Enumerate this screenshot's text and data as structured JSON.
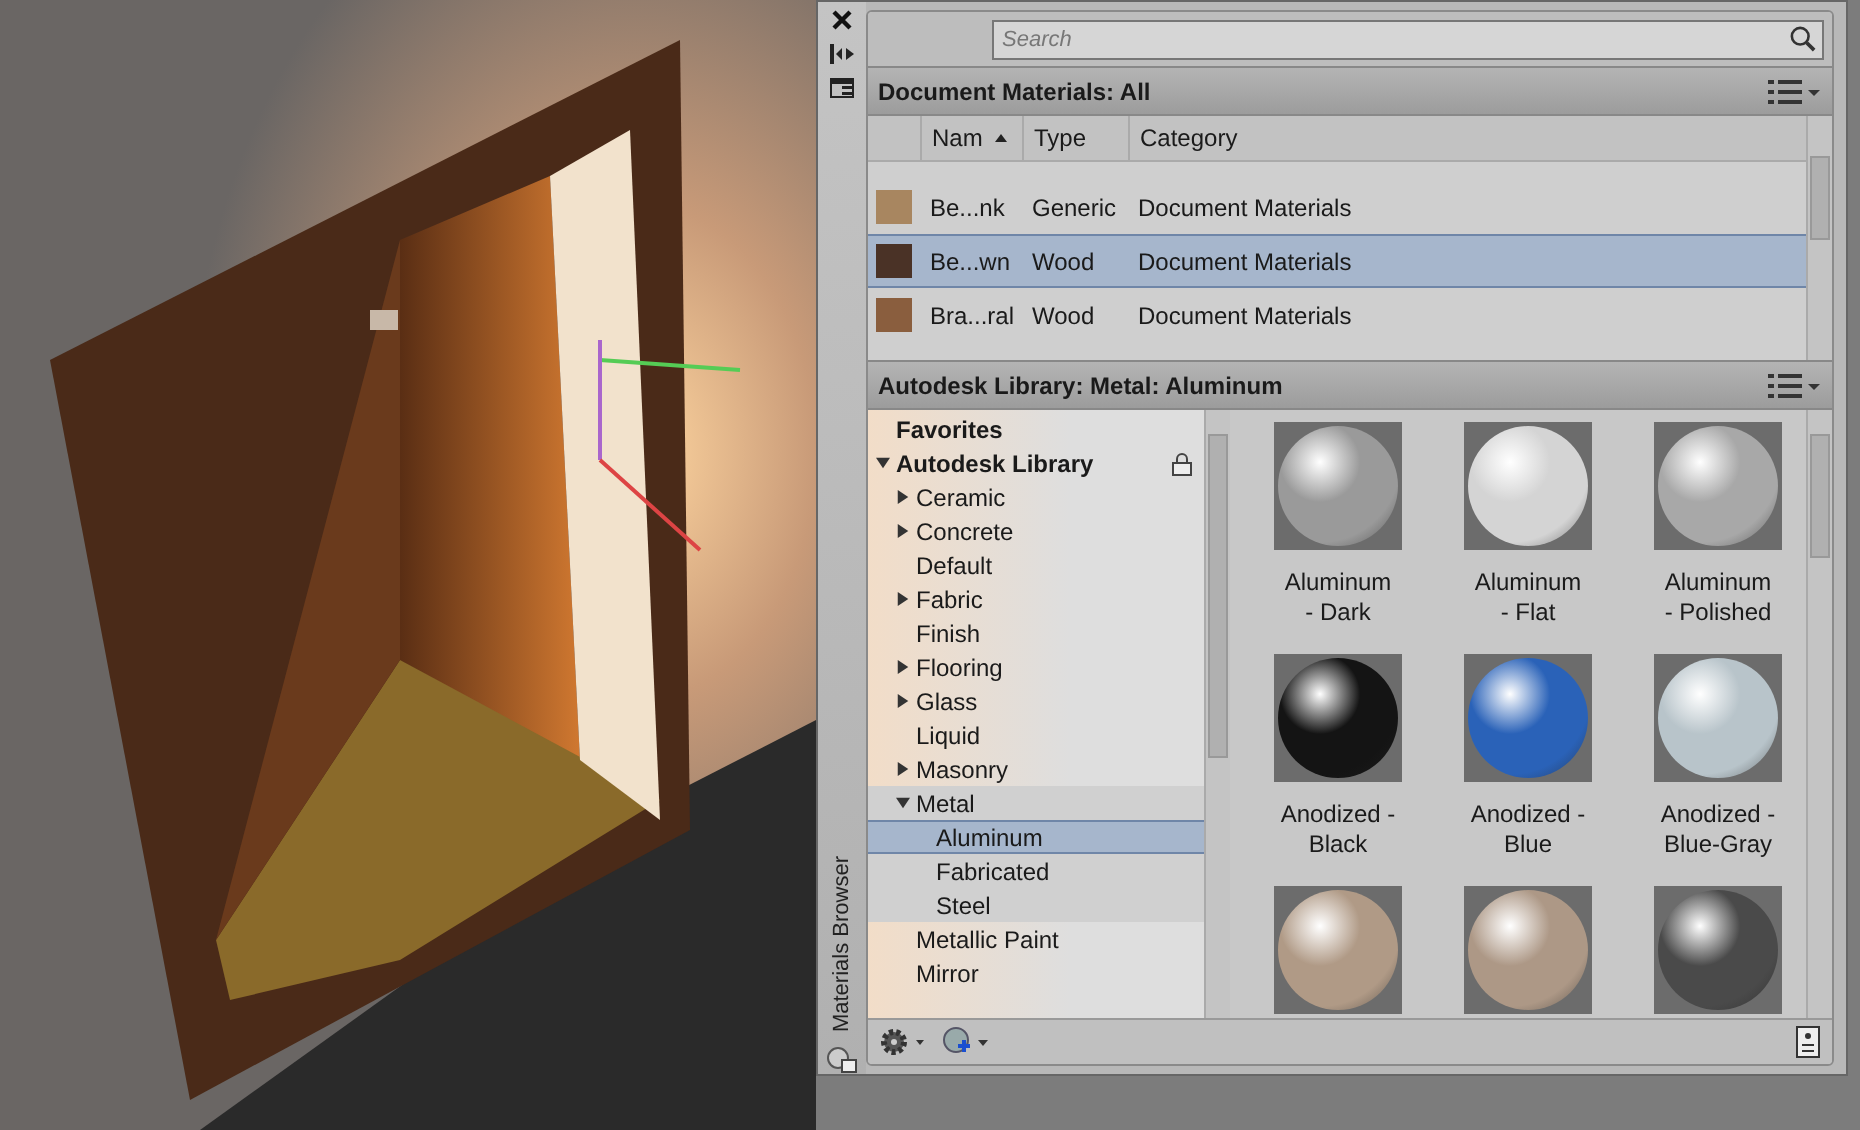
{
  "side_strip": {
    "title": "Materials Browser"
  },
  "search": {
    "placeholder": "Search"
  },
  "document_materials": {
    "title": "Document Materials: All",
    "columns": [
      {
        "label": "Nam",
        "sorted": true
      },
      {
        "label": "Type",
        "sorted": false
      },
      {
        "label": "Category",
        "sorted": false
      }
    ],
    "rows": [
      {
        "color": "#a88660",
        "name": "Be...nk",
        "type": "Generic",
        "category": "Document Materials",
        "selected": false
      },
      {
        "color": "#4a3226",
        "name": "Be...wn",
        "type": "Wood",
        "category": "Document Materials",
        "selected": true
      },
      {
        "color": "#8a5e3e",
        "name": "Bra...ral",
        "type": "Wood",
        "category": "Document Materials",
        "selected": false
      }
    ]
  },
  "library": {
    "title": "Autodesk Library: Metal: Aluminum",
    "tree": [
      {
        "label": "Favorites",
        "selected": false
      },
      {
        "label": "Autodesk Library",
        "expanded": true,
        "locked": true,
        "selected": false,
        "children": [
          {
            "label": "Ceramic",
            "expanded": false,
            "selected": false
          },
          {
            "label": "Concrete",
            "expanded": false,
            "selected": false
          },
          {
            "label": "Default",
            "selected": false
          },
          {
            "label": "Fabric",
            "expanded": false,
            "selected": false
          },
          {
            "label": "Finish",
            "selected": false
          },
          {
            "label": "Flooring",
            "expanded": false,
            "selected": false
          },
          {
            "label": "Glass",
            "expanded": false,
            "selected": false
          },
          {
            "label": "Liquid",
            "selected": false
          },
          {
            "label": "Masonry",
            "expanded": false,
            "selected": false
          },
          {
            "label": "Metal",
            "expanded": true,
            "selected": false,
            "children": [
              {
                "label": "Aluminum",
                "selected": true
              },
              {
                "label": "Fabricated",
                "selected": false
              },
              {
                "label": "Steel",
                "selected": false
              }
            ]
          },
          {
            "label": "Metallic Paint",
            "selected": false
          },
          {
            "label": "Mirror",
            "selected": false
          }
        ]
      }
    ],
    "tiles": [
      {
        "label": "Aluminum - Dark",
        "color": "#9a9a9a"
      },
      {
        "label": "Aluminum - Flat",
        "color": "#d4d4d4"
      },
      {
        "label": "Aluminum - Polished",
        "color": "#a8a8a8"
      },
      {
        "label": "Anodized - Black",
        "color": "#141414"
      },
      {
        "label": "Anodized - Blue",
        "color": "#2a62b8"
      },
      {
        "label": "Anodized - Blue-Gray",
        "color": "#b8c4ca"
      },
      {
        "color": "#b09a86"
      },
      {
        "color": "#ad9886"
      },
      {
        "color": "#4a4a4a"
      }
    ]
  }
}
